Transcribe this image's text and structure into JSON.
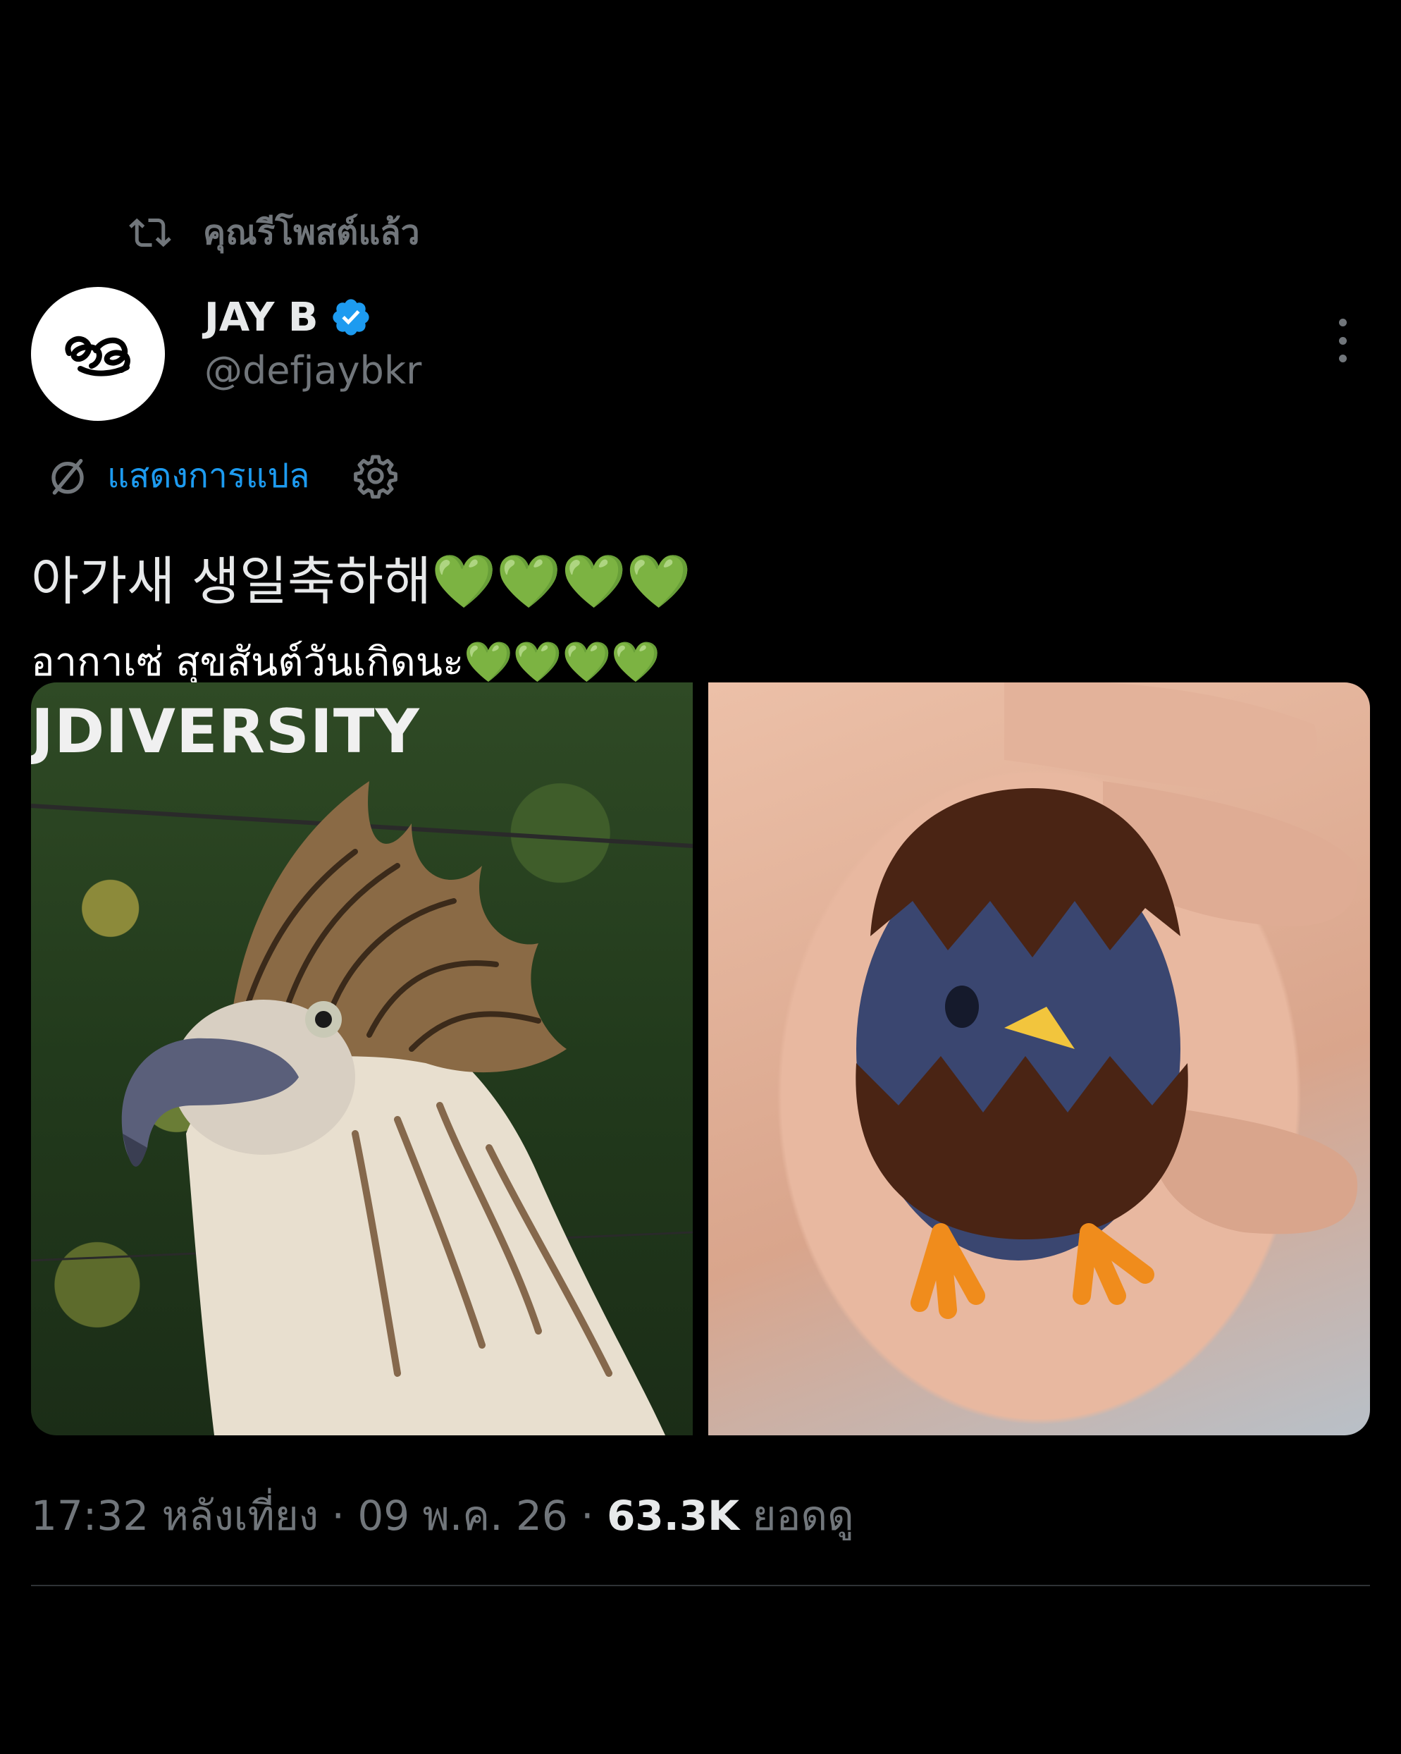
{
  "retweet": {
    "label": "คุณรีโพสต์แล้ว",
    "icon": "retweet-icon"
  },
  "author": {
    "display_name": "JAY B",
    "handle": "@defjaybkr",
    "verified_icon": "verified-badge-icon",
    "avatar_icon": "signature-logo"
  },
  "menu": {
    "icon": "more-vertical-icon"
  },
  "translate": {
    "label": "แสดงการแปล",
    "icon": "translate-icon",
    "settings_icon": "gear-icon"
  },
  "tweet": {
    "line1_text": "아가새 생일축하해",
    "line1_hearts": "💚💚💚💚",
    "line2_text": "อากาเซ่ สุขสันต์วันเกิดนะ",
    "line2_hearts": "💚💚💚💚"
  },
  "media": {
    "image1_caption_text": "JDIVERSITY",
    "image1_subject": "philippine-eagle-photo",
    "image2_subject": "egg-chick-figure-photo"
  },
  "meta": {
    "time": "17:32 หลังเที่ยง",
    "separator": " · ",
    "date": "09 พ.ค. 26",
    "views_count": "63.3K",
    "views_label": "ยอดดู"
  },
  "colors": {
    "background": "#000000",
    "primary_text": "#e7e9ea",
    "secondary_text": "#71767b",
    "link_blue": "#1d9bf0",
    "heart_green": "#6cbb3c"
  }
}
